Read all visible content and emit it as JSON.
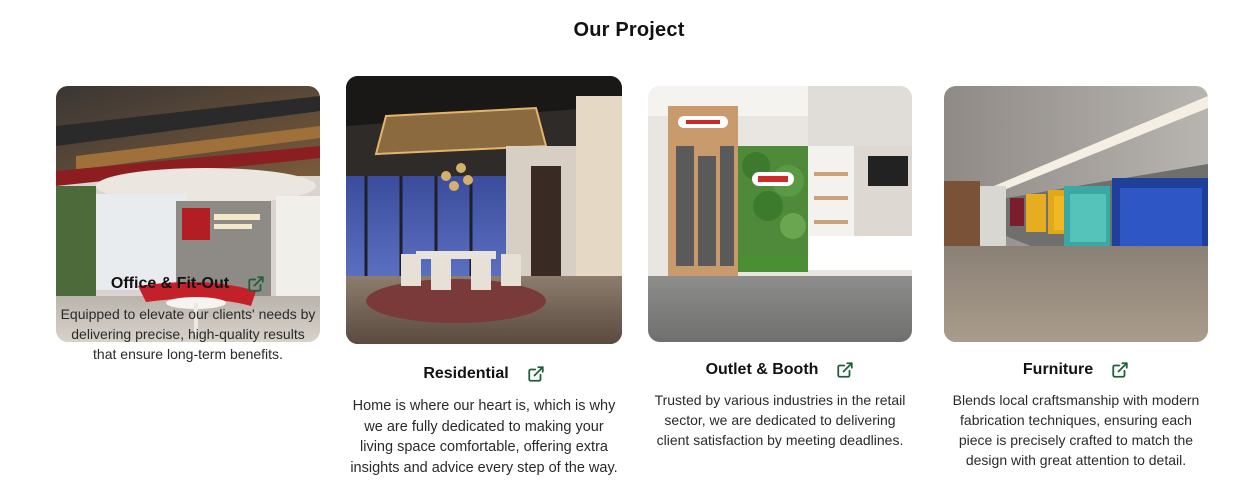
{
  "section": {
    "title": "Our Project"
  },
  "colors": {
    "link_icon": "#1f5f3a",
    "title_text": "#111111",
    "body_text": "#2a2a2a"
  },
  "projects": [
    {
      "title": "Office & Fit-Out",
      "icon": "external-link-icon",
      "description": "Equipped to elevate our clients' needs by delivering precise, high-quality results that ensure long-term benefits."
    },
    {
      "title": "Residential",
      "icon": "external-link-icon",
      "description": "Home is where our heart is, which is why we are fully dedicated to making your living space comfortable, offering extra insights and advice every step of the way."
    },
    {
      "title": "Outlet & Booth",
      "icon": "external-link-icon",
      "description": "Trusted by various industries in the retail sector, we are dedicated to delivering client satisfaction by meeting deadlines."
    },
    {
      "title": "Furniture",
      "icon": "external-link-icon",
      "description": "Blends local craftsmanship with modern fabrication techniques, ensuring each piece is precisely crafted to match the design with great attention to detail."
    }
  ]
}
